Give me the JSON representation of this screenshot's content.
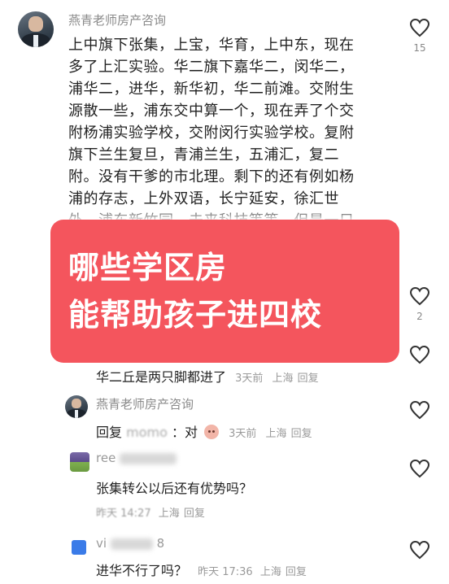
{
  "comment_main": {
    "author": "燕青老师房产咨询",
    "text": "上中旗下张集，上宝，华育，上中东，现在\n多了上汇实验。华二旗下嘉华二，闵华二，\n浦华二，进华，新华初，华二前滩。交附生\n源散一些，浦东交中算一个，现在弄了个交\n附杨浦实验学校，交附闵行实验学校。复附\n旗下兰生复旦，青浦兰生，五浦汇，复二\n附。没有干爹的市北理。剩下的还有例如杨\n浦的存志，上外双语，长宁延安，徐汇世\n外，浦东新竹园，未来科技等等。但是一只",
    "likes": "15"
  },
  "banner": {
    "line1": "哪些学区房",
    "line2": "能帮助孩子进四校"
  },
  "hidden_comment": {
    "likes": "2"
  },
  "reply_1": {
    "text": "华二丘是两只脚都进了",
    "time": "3天前",
    "location": "上海",
    "reply_label": "回复"
  },
  "reply_2": {
    "author": "燕青老师房产咨询",
    "prefix": "回复",
    "mention": "momo",
    "text": "：对",
    "time": "3天前",
    "location": "上海",
    "reply_label": "回复"
  },
  "reply_3": {
    "author_partial": "ree",
    "text": "张集转公以后还有优势吗？",
    "time": "昨天 14:27",
    "location": "上海",
    "reply_label": "回复"
  },
  "reply_4": {
    "author_partial": "vi",
    "author_suffix": "8",
    "text": "进华不行了吗？",
    "time": "昨天 17:36",
    "location": "上海",
    "reply_label": "回复"
  },
  "colors": {
    "banner_bg": "#f4555d",
    "meta_text": "#9a9a9a",
    "author_text": "#8a8a8a"
  },
  "icons": [
    "heart-outline-icon",
    "avatar-icon",
    "emoji-blush-icon"
  ]
}
